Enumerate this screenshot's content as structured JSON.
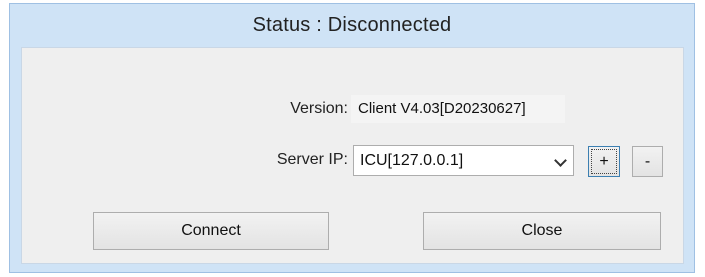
{
  "window": {
    "title": "Status : Disconnected"
  },
  "form": {
    "version_label": "Version:",
    "version_value": "Client V4.03[D20230627]",
    "server_ip_label": "Server IP:",
    "server_ip_selected": "ICU[127.0.0.1]",
    "add_button_label": "+",
    "remove_button_label": "-"
  },
  "actions": {
    "connect_label": "Connect",
    "close_label": "Close"
  },
  "icons": {
    "dropdown": "chevron-down-icon"
  },
  "colors": {
    "title_bar": "#cfe3f6",
    "panel": "#efefef",
    "focus_border": "#3c7fb1"
  }
}
